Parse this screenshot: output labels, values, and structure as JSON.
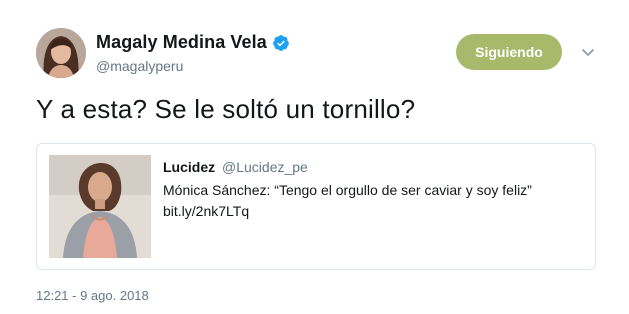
{
  "author": {
    "display_name": "Magaly Medina Vela",
    "handle": "@magalyperu",
    "verified_icon": "verified-badge-icon"
  },
  "actions": {
    "follow_label": "Siguiendo",
    "caret_icon": "chevron-down-icon"
  },
  "tweet": {
    "text": "Y a esta? Se le soltó un tornillo?",
    "timestamp": "12:21 - 9 ago. 2018"
  },
  "quote": {
    "name": "Lucidez",
    "handle": "@Lucidez_pe",
    "text": "Mónica Sánchez: “Tengo el orgullo de ser caviar y soy feliz”",
    "link": "bit.ly/2nk7LTq"
  },
  "colors": {
    "follow_button_bg": "#a8b96c",
    "verified_blue": "#1da1f2",
    "secondary_text": "#657786",
    "card_border": "#e1e8ed"
  }
}
